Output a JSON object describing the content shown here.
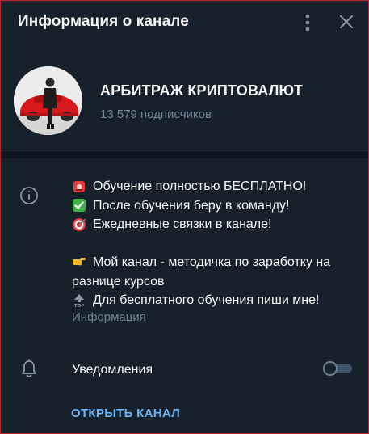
{
  "header": {
    "title": "Информация о канале",
    "menu_icon": "vertical-dots-icon",
    "close_icon": "close-icon"
  },
  "profile": {
    "name": "АРБИТРАЖ КРИПТОВАЛЮТ",
    "subscribers": "13 579 подписчиков",
    "avatar": "avatar-man-with-red-car"
  },
  "description": {
    "lines": [
      {
        "icon": "rotating-light-emoji",
        "text": "Обучение полностью БЕСПЛАТНО!"
      },
      {
        "icon": "check-mark-button-emoji",
        "text": "После обучения беру в команду!"
      },
      {
        "icon": "direct-hit-emoji",
        "text": "Ежедневные связки в канале!"
      },
      {
        "icon": "backhand-index-pointing-right-emoji",
        "text": "Мой канал - методичка по заработку на разнице курсов"
      },
      {
        "icon": "top-arrow-emoji",
        "text": "Для бесплатного обучения пиши мне!"
      }
    ],
    "label": "Информация",
    "icon": "info-icon"
  },
  "notifications": {
    "label": "Уведомления",
    "enabled": false,
    "icon": "bell-icon"
  },
  "actions": {
    "open_channel": "ОТКРЫТЬ КАНАЛ"
  },
  "colors": {
    "background": "#17212b",
    "divider": "#0e1621",
    "text": "#f5f5f5",
    "muted": "#708499",
    "accent": "#6ab3f3",
    "border": "#b3262d"
  }
}
